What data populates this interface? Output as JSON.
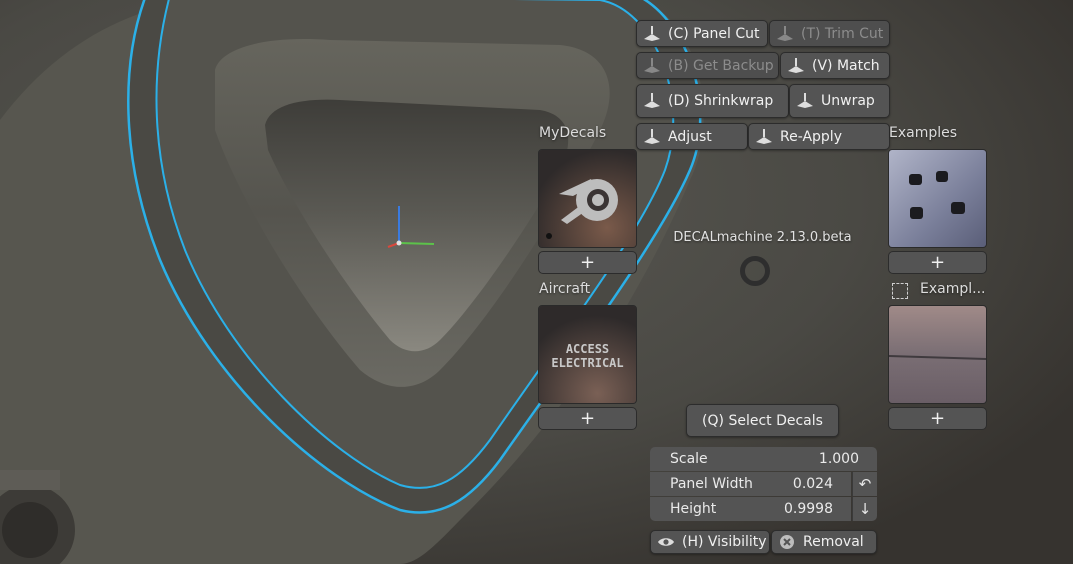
{
  "toolbar": {
    "panel_cut": "(C) Panel Cut",
    "trim_cut": "(T) Trim Cut",
    "get_backup": "(B) Get Backup",
    "match": "(V) Match",
    "shrinkwrap": "(D) Shrinkwrap",
    "unwrap": "Unwrap",
    "adjust": "Adjust",
    "reapply": "Re-Apply"
  },
  "libraries": {
    "mydecals": {
      "title": "MyDecals",
      "decal_icon": "blender-logo-icon",
      "add": "+"
    },
    "aircraft": {
      "title": "Aircraft",
      "decal_text_line1": "ACCESS",
      "decal_text_line2": "ELECTRICAL",
      "add": "+"
    },
    "examples": {
      "title": "Examples",
      "add": "+"
    },
    "examples2": {
      "title": "Exampl...",
      "add": "+"
    }
  },
  "status": {
    "version": "DECALmachine 2.13.0.beta"
  },
  "select_decals": "(Q) Select Decals",
  "properties": [
    {
      "label": "Scale",
      "value": "1.000"
    },
    {
      "label": "Panel Width",
      "value": "0.024"
    },
    {
      "label": "Height",
      "value": "0.9998"
    }
  ],
  "bottom": {
    "visibility": "(H) Visibility",
    "removal": "Removal"
  },
  "colors": {
    "outline": "#2bb0e8",
    "button_bg": "#545454",
    "disabled_text": "#8c8c8c"
  }
}
